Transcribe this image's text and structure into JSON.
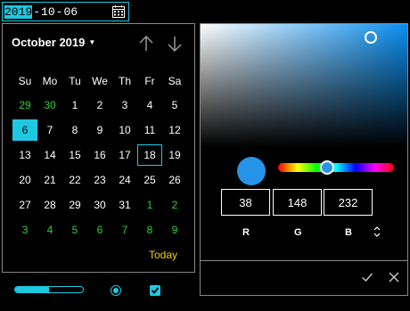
{
  "date_input": {
    "year": "2019",
    "month": "10",
    "day": "06",
    "separator": "-"
  },
  "calendar": {
    "month_label": "October 2019",
    "weekdays": [
      "Su",
      "Mo",
      "Tu",
      "We",
      "Th",
      "Fr",
      "Sa"
    ],
    "weeks": [
      [
        {
          "d": "29",
          "o": true
        },
        {
          "d": "30",
          "o": true
        },
        {
          "d": "1"
        },
        {
          "d": "2"
        },
        {
          "d": "3"
        },
        {
          "d": "4"
        },
        {
          "d": "5"
        }
      ],
      [
        {
          "d": "6",
          "sel": true
        },
        {
          "d": "7"
        },
        {
          "d": "8"
        },
        {
          "d": "9"
        },
        {
          "d": "10"
        },
        {
          "d": "11"
        },
        {
          "d": "12"
        }
      ],
      [
        {
          "d": "13"
        },
        {
          "d": "14"
        },
        {
          "d": "15"
        },
        {
          "d": "16"
        },
        {
          "d": "17"
        },
        {
          "d": "18",
          "today": true
        },
        {
          "d": "19"
        }
      ],
      [
        {
          "d": "20"
        },
        {
          "d": "21"
        },
        {
          "d": "22"
        },
        {
          "d": "23"
        },
        {
          "d": "24"
        },
        {
          "d": "25"
        },
        {
          "d": "26"
        }
      ],
      [
        {
          "d": "27"
        },
        {
          "d": "28"
        },
        {
          "d": "29"
        },
        {
          "d": "30"
        },
        {
          "d": "31"
        },
        {
          "d": "1",
          "o": true
        },
        {
          "d": "2",
          "o": true
        }
      ],
      [
        {
          "d": "3",
          "o": true
        },
        {
          "d": "4",
          "o": true
        },
        {
          "d": "5",
          "o": true
        },
        {
          "d": "6",
          "o": true
        },
        {
          "d": "7",
          "o": true
        },
        {
          "d": "8",
          "o": true
        },
        {
          "d": "9",
          "o": true
        }
      ]
    ],
    "today_label": "Today"
  },
  "controls": {
    "slider_value": 0.5,
    "radio_checked": true,
    "checkbox_checked": true
  },
  "color_picker": {
    "color": "#2694e8",
    "channels": [
      {
        "label": "R",
        "value": "38"
      },
      {
        "label": "G",
        "value": "148"
      },
      {
        "label": "B",
        "value": "232"
      }
    ],
    "mode_toggle_icon": "up-down-arrows-icon"
  },
  "colors": {
    "accent": "#1ec8e0",
    "other_month": "#28d428",
    "today_link": "#f0d000"
  }
}
